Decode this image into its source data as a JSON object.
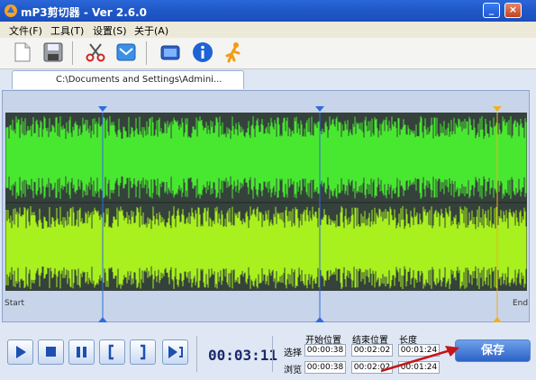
{
  "window": {
    "title": "mP3剪切器 - Ver 2.6.0",
    "minimize_glyph": "_",
    "close_glyph": "×"
  },
  "menu": [
    "文件(F)",
    "工具(T)",
    "设置(S)",
    "关于(A)"
  ],
  "toolbar": {
    "icons": [
      "new-file-icon",
      "save-icon",
      "cut-icon",
      "mail-icon",
      "screen-icon",
      "info-icon",
      "runner-icon"
    ]
  },
  "tab": {
    "label": "C:\\Documents and Settings\\Admini..."
  },
  "waveform": {
    "start_label": "Start",
    "end_label": "End",
    "channel_colors": [
      "#49e830",
      "#a8f01e"
    ],
    "background": "#35423c",
    "markers": [
      "start-marker",
      "end-marker",
      "playhead-marker"
    ]
  },
  "controls": {
    "icons": [
      "play-icon",
      "stop-icon",
      "pause-icon",
      "set-start-icon",
      "set-end-icon",
      "play-selection-icon"
    ],
    "current_time": "00:03:11"
  },
  "selection": {
    "headers": {
      "start": "开始位置",
      "end": "结束位置",
      "length": "长度"
    },
    "rows": [
      {
        "label": "选择",
        "start": "00:00:38",
        "end": "00:02:02",
        "length": "00:01:24"
      },
      {
        "label": "浏览",
        "start": "00:00:38",
        "end": "00:02:02",
        "length": "00:01:24"
      }
    ]
  },
  "save_button": "保存",
  "colors": {
    "title_bar": "#1f58c9",
    "accent": "#2c62c7",
    "arrow": "#c4161c"
  }
}
